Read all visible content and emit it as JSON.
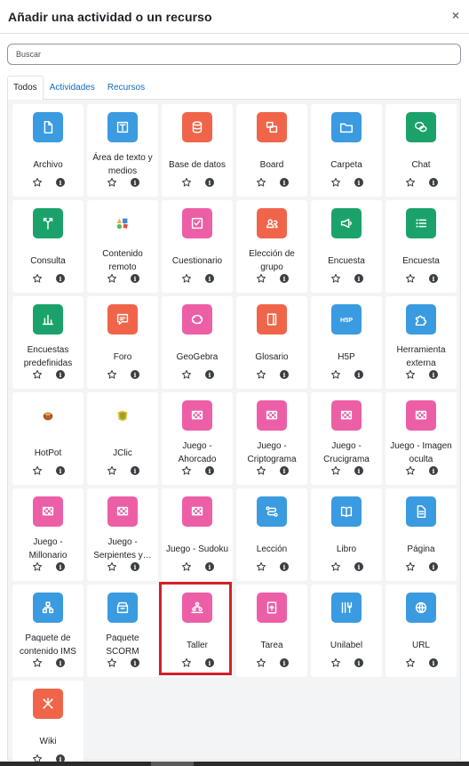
{
  "modal": {
    "title": "Añadir una actividad o un recurso",
    "close_label": "×"
  },
  "search": {
    "placeholder": "Buscar",
    "value": ""
  },
  "tabs": [
    {
      "label": "Todos",
      "active": true
    },
    {
      "label": "Actividades",
      "active": false
    },
    {
      "label": "Recursos",
      "active": false
    }
  ],
  "colors": {
    "blue": "#3b9be0",
    "red": "#f06549",
    "pink": "#ec5fa6",
    "green": "#1ba26b",
    "highlight": "#d3202b"
  },
  "items": [
    {
      "name": "Archivo",
      "color": "blue",
      "icon": "file-icon"
    },
    {
      "name": "Área de texto y medios",
      "color": "blue",
      "icon": "text-area-icon"
    },
    {
      "name": "Base de datos",
      "color": "red",
      "icon": "database-icon"
    },
    {
      "name": "Board",
      "color": "red",
      "icon": "board-icon"
    },
    {
      "name": "Carpeta",
      "color": "blue",
      "icon": "folder-icon"
    },
    {
      "name": "Chat",
      "color": "green",
      "icon": "chat-icon"
    },
    {
      "name": "Consulta",
      "color": "green",
      "icon": "choice-icon"
    },
    {
      "name": "Contenido remoto",
      "color": "plugin",
      "icon": "shapes-icon"
    },
    {
      "name": "Cuestionario",
      "color": "pink",
      "icon": "quiz-icon"
    },
    {
      "name": "Elección de grupo",
      "color": "red",
      "icon": "group-choice-icon"
    },
    {
      "name": "Encuesta",
      "color": "green",
      "icon": "megaphone-icon"
    },
    {
      "name": "Encuesta",
      "color": "green",
      "icon": "list-icon"
    },
    {
      "name": "Encuestas predefinidas",
      "color": "green",
      "icon": "bar-chart-icon"
    },
    {
      "name": "Foro",
      "color": "red",
      "icon": "forum-icon"
    },
    {
      "name": "GeoGebra",
      "color": "pink",
      "icon": "geogebra-icon"
    },
    {
      "name": "Glosario",
      "color": "red",
      "icon": "glossary-icon"
    },
    {
      "name": "H5P",
      "color": "blue",
      "icon": "h5p-icon"
    },
    {
      "name": "Herramienta externa",
      "color": "blue",
      "icon": "puzzle-icon"
    },
    {
      "name": "HotPot",
      "color": "plugin",
      "icon": "hotpot-icon"
    },
    {
      "name": "JClic",
      "color": "plugin",
      "icon": "jclic-icon"
    },
    {
      "name": "Juego - Ahorcado",
      "color": "pink",
      "icon": "game-icon"
    },
    {
      "name": "Juego - Criptograma",
      "color": "pink",
      "icon": "game-icon"
    },
    {
      "name": "Juego - Crucigrama",
      "color": "pink",
      "icon": "game-icon"
    },
    {
      "name": "Juego - Imagen oculta",
      "color": "pink",
      "icon": "game-icon"
    },
    {
      "name": "Juego - Millonario",
      "color": "pink",
      "icon": "game-icon"
    },
    {
      "name": "Juego - Serpientes y…",
      "color": "pink",
      "icon": "game-icon"
    },
    {
      "name": "Juego - Sudoku",
      "color": "pink",
      "icon": "game-icon"
    },
    {
      "name": "Lección",
      "color": "blue",
      "icon": "lesson-icon"
    },
    {
      "name": "Libro",
      "color": "blue",
      "icon": "book-icon"
    },
    {
      "name": "Página",
      "color": "blue",
      "icon": "page-icon"
    },
    {
      "name": "Paquete de contenido IMS",
      "color": "blue",
      "icon": "ims-package-icon"
    },
    {
      "name": "Paquete SCORM",
      "color": "blue",
      "icon": "scorm-package-icon"
    },
    {
      "name": "Taller",
      "color": "pink",
      "icon": "workshop-icon"
    },
    {
      "name": "Tarea",
      "color": "pink",
      "icon": "assignment-icon"
    },
    {
      "name": "Unilabel",
      "color": "blue",
      "icon": "unilabel-icon"
    },
    {
      "name": "URL",
      "color": "blue",
      "icon": "globe-icon"
    },
    {
      "name": "Wiki",
      "color": "red",
      "icon": "wiki-icon"
    }
  ],
  "info_glyph": "i"
}
